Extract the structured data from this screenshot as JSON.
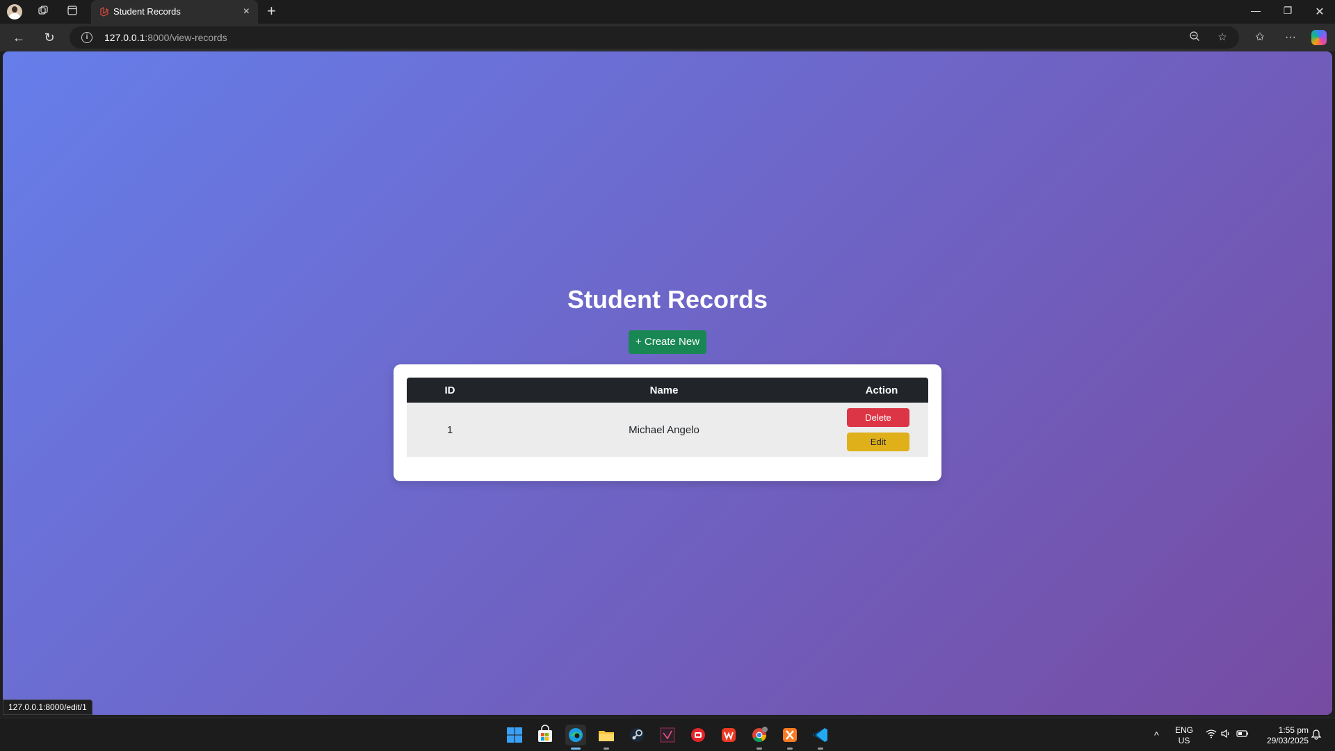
{
  "browser": {
    "tab_title": "Student Records",
    "url_host": "127.0.0.1",
    "url_rest": ":8000/view-records",
    "status_url": "127.0.0.1:8000/edit/1"
  },
  "page": {
    "title": "Student Records",
    "create_button": "+ Create New",
    "table": {
      "headers": [
        "ID",
        "Name",
        "Action"
      ],
      "rows": [
        {
          "id": "1",
          "name": "Michael Angelo",
          "delete_label": "Delete",
          "edit_label": "Edit"
        }
      ]
    },
    "colors": {
      "gradient_start": "#667eea",
      "gradient_end": "#764ba2",
      "create": "#198754",
      "delete": "#dc3545",
      "edit": "#e0b01a",
      "table_header": "#212529"
    }
  },
  "taskbar": {
    "lang_primary": "ENG",
    "lang_secondary": "US",
    "time": "1:55 pm",
    "date": "29/03/2025",
    "apps": [
      "windows-start-icon",
      "microsoft-store-icon",
      "edge-icon",
      "file-explorer-icon",
      "steam-icon",
      "vector-app-icon",
      "red-app-icon",
      "wps-office-icon",
      "chrome-icon",
      "xampp-icon",
      "vscode-icon"
    ]
  }
}
